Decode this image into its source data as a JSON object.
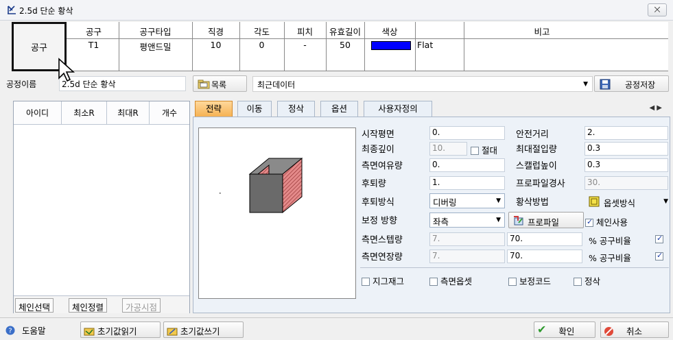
{
  "window": {
    "title": "2.5d 단순 황삭",
    "icon": "mill-icon",
    "close_symbol": "⨉"
  },
  "tool_table": {
    "button_label": "공구",
    "headers": [
      "공구",
      "공구타입",
      "직경",
      "각도",
      "피치",
      "유효길이",
      "색상",
      "비고"
    ],
    "row": [
      "T1",
      "평앤드밀",
      "10",
      "0",
      "-",
      "50",
      "",
      "Flat"
    ],
    "color": "#0000ff"
  },
  "process": {
    "label": "공정이름",
    "name_value": "2.5d 단순 황삭",
    "list_button": "목록",
    "recent_label": "최근데이터",
    "save_button": "공정저장"
  },
  "left_panel": {
    "headers": [
      "아이디",
      "최소R",
      "최대R",
      "개수"
    ],
    "buttons": [
      "체인선택",
      "체인정렬",
      "가공시점"
    ]
  },
  "tabs": [
    "전략",
    "이동",
    "정삭",
    "옵션",
    "사용자정의"
  ],
  "strategy": {
    "start_plane": {
      "label": "시작평면",
      "value": "0."
    },
    "final_depth": {
      "label": "최종깊이",
      "value": "10.",
      "abs_label": "절대"
    },
    "side_allowance": {
      "label": "측면여유량",
      "value": "0."
    },
    "retract": {
      "label": "후퇴량",
      "value": "1."
    },
    "retract_mode": {
      "label": "후퇴방식",
      "value": "디버링"
    },
    "comp_dir": {
      "label": "보정 방향",
      "value": "좌측"
    },
    "side_step": {
      "label": "측면스텝량",
      "value": "7."
    },
    "side_extend": {
      "label": "측면연장량",
      "value": "7."
    },
    "safe_dist": {
      "label": "안전거리",
      "value": "2."
    },
    "max_cut": {
      "label": "최대절입량",
      "value": "0.3"
    },
    "scallop": {
      "label": "스캘럽높이",
      "value": "0.3"
    },
    "profile_tol": {
      "label": "프로파일경사",
      "value": "30."
    },
    "rough_mode": {
      "label": "황삭방법",
      "value": "옵셋방식"
    },
    "profile_button": "프로파일",
    "chain_use": {
      "label": "체인사용",
      "checked": true
    },
    "ratio1": {
      "value": "70.",
      "label": "% 공구비율",
      "checked": true
    },
    "ratio2": {
      "value": "70.",
      "label": "% 공구비율",
      "checked": true
    },
    "bottom_checks": [
      "지그재그",
      "측면옵셋",
      "보정코드",
      "정삭"
    ]
  },
  "footer": {
    "help": "도움말",
    "read_init": "초기값읽기",
    "write_init": "초기값쓰기",
    "ok": "확인",
    "cancel": "취소"
  }
}
